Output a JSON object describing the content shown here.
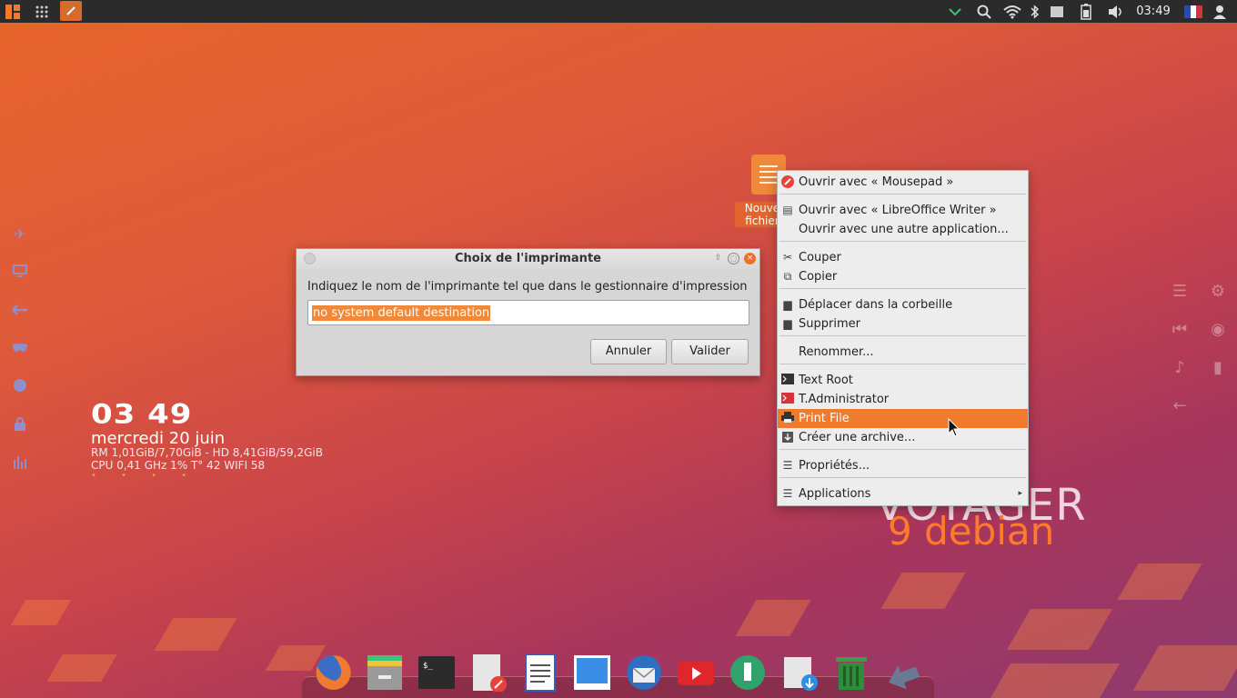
{
  "top_panel": {
    "clock": "03:49",
    "icons": [
      "whisker-menu-icon",
      "apps-grid-icon",
      "active-window-icon",
      "chevron-down-icon",
      "search-icon",
      "wifi-icon",
      "bluetooth-icon",
      "display-icon",
      "battery-icon",
      "volume-icon",
      "french-flag-icon",
      "user-icon"
    ]
  },
  "desktop": {
    "file_label_line1": "Nouve",
    "file_label_line2": "fichier",
    "brand_title": "VOYAGER",
    "brand_subtitle": "9 debian"
  },
  "conky": {
    "time": "03 49",
    "date": "mercredi 20 juin",
    "memory_line": "RM 1,01GiB/7,70GiB - HD 8,41GiB/59,2GiB",
    "cpu_line": "CPU 0,41 GHz 1% T° 42  WIFI 58",
    "dots": "• • • •"
  },
  "dialog": {
    "title": "Choix de l'imprimante",
    "prompt": "Indiquez le nom de l'imprimante tel que dans le gestionnaire d'impression",
    "input_value": "no system default destination",
    "cancel_label": "Annuler",
    "ok_label": "Valider"
  },
  "context_menu": {
    "items": [
      {
        "label": "Ouvrir avec « Mousepad »",
        "icon": "mousepad-icon"
      },
      {
        "label": "Ouvrir avec « LibreOffice Writer »",
        "icon": "document-icon"
      },
      {
        "label": "Ouvrir avec une autre application...",
        "icon": ""
      },
      {
        "label": "Couper",
        "icon": "scissors-icon"
      },
      {
        "label": "Copier",
        "icon": "copy-icon"
      },
      {
        "label": "Déplacer dans la corbeille",
        "icon": "trash-icon"
      },
      {
        "label": "Supprimer",
        "icon": "delete-icon"
      },
      {
        "label": "Renommer...",
        "icon": ""
      },
      {
        "label": "Text Root",
        "icon": "terminal-icon"
      },
      {
        "label": "T.Administrator",
        "icon": "admin-terminal-icon"
      },
      {
        "label": "Print File",
        "icon": "printer-icon"
      },
      {
        "label": "Créer une archive...",
        "icon": "archive-icon"
      },
      {
        "label": "Propriétés...",
        "icon": "properties-icon"
      },
      {
        "label": "Applications",
        "icon": "applications-icon"
      }
    ],
    "selected_index": 10
  },
  "dock": {
    "icons": [
      "firefox-icon",
      "file-manager-icon",
      "terminal-icon",
      "text-editor-icon",
      "writer-icon",
      "screen-icon",
      "thunderbird-icon",
      "youtube-icon",
      "synaptic-icon",
      "downloads-icon",
      "trash-icon",
      "back-arrow-icon"
    ]
  },
  "colors": {
    "accent": "#f07a2e",
    "panel": "#2b2b2b"
  }
}
